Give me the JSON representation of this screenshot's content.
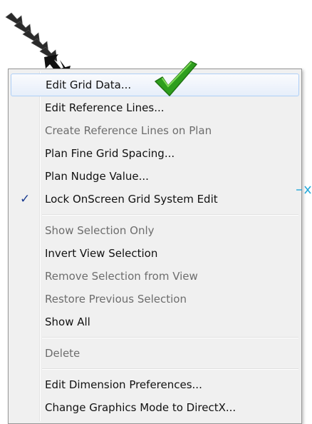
{
  "menu": {
    "section_1": [
      {
        "label": "Edit Grid Data...",
        "state": "highlighted"
      },
      {
        "label": "Edit Reference Lines...",
        "state": "enabled"
      },
      {
        "label": "Create Reference Lines on Plan",
        "state": "disabled"
      },
      {
        "label": "Plan Fine Grid Spacing...",
        "state": "enabled"
      },
      {
        "label": "Plan Nudge Value...",
        "state": "enabled"
      },
      {
        "label": "Lock OnScreen Grid System Edit",
        "state": "checked",
        "check_glyph": "✓"
      }
    ],
    "section_2": [
      {
        "label": "Show Selection Only",
        "state": "disabled"
      },
      {
        "label": "Invert View Selection",
        "state": "enabled"
      },
      {
        "label": "Remove Selection from View",
        "state": "disabled"
      },
      {
        "label": "Restore Previous Selection",
        "state": "disabled"
      },
      {
        "label": "Show All",
        "state": "enabled"
      }
    ],
    "section_3": [
      {
        "label": "Delete",
        "state": "disabled"
      }
    ],
    "section_4": [
      {
        "label": "Edit Dimension Preferences...",
        "state": "enabled"
      },
      {
        "label": "Change Graphics Mode to DirectX...",
        "state": "enabled"
      }
    ]
  },
  "colors": {
    "menu_background": "#f0f0f0",
    "menu_border": "#979797",
    "highlight_border": "#aecff7",
    "enabled_text": "#111111",
    "disabled_text": "#6d6d6d",
    "check_color": "#1a3b8f",
    "green_check": "#2e9e1e",
    "cursor_arrow": "#1c1c1c",
    "side_marker": "#25a8d9"
  },
  "icons": {
    "annotation_arrow": "black-cursor-arrow-icon",
    "annotation_check": "green-checkmark-icon",
    "side_marker": "cyan-cross-marker-icon"
  }
}
